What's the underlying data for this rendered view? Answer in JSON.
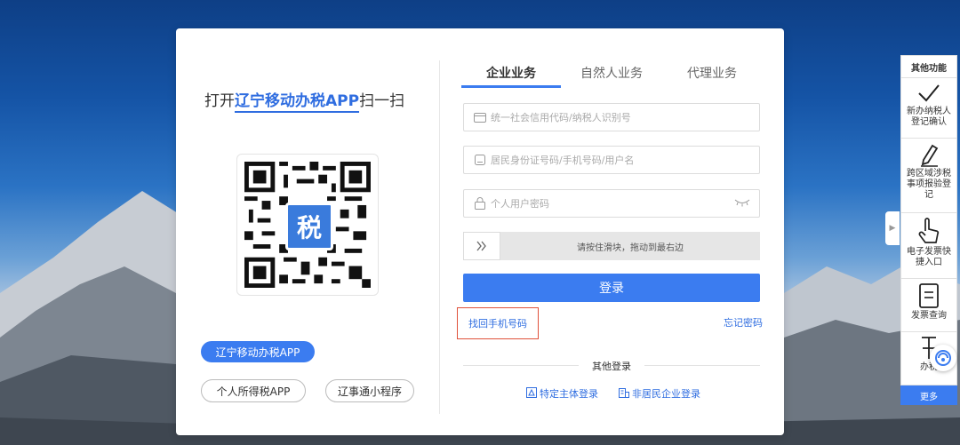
{
  "qr": {
    "prefix": "打开",
    "highlight": "辽宁移动办税APP",
    "suffix": "扫一扫",
    "logo_char": "税"
  },
  "left_buttons": {
    "primary": "辽宁移动办税APP",
    "personal_tax": "个人所得税APP",
    "mini_program": "辽事通小程序"
  },
  "tabs": [
    "企业业务",
    "自然人业务",
    "代理业务"
  ],
  "form": {
    "credit_code_placeholder": "统一社会信用代码/纳税人识别号",
    "id_placeholder": "居民身份证号码/手机号码/用户名",
    "password_placeholder": "个人用户密码",
    "slider_text": "请按住滑块，拖动到最右边",
    "login_label": "登录",
    "find_phone": "找回手机号码",
    "forgot_password": "忘记密码"
  },
  "other_login": {
    "title": "其他登录",
    "special_entity": "特定主体登录",
    "non_resident": "非居民企业登录"
  },
  "side_panel": {
    "title": "其他功能",
    "items": [
      {
        "label": "新办纳税人登记确认",
        "icon": "check-icon"
      },
      {
        "label": "跨区域涉税事项报验登记",
        "icon": "pen-icon"
      },
      {
        "label": "电子发票快捷入口",
        "icon": "hand-pointer-icon"
      },
      {
        "label": "发票查询",
        "icon": "document-icon"
      },
      {
        "label": "办税",
        "icon": "tax-service-icon"
      }
    ],
    "more": "更多"
  },
  "colors": {
    "accent": "#3b7cf0",
    "highlight_box": "#e0513a"
  }
}
